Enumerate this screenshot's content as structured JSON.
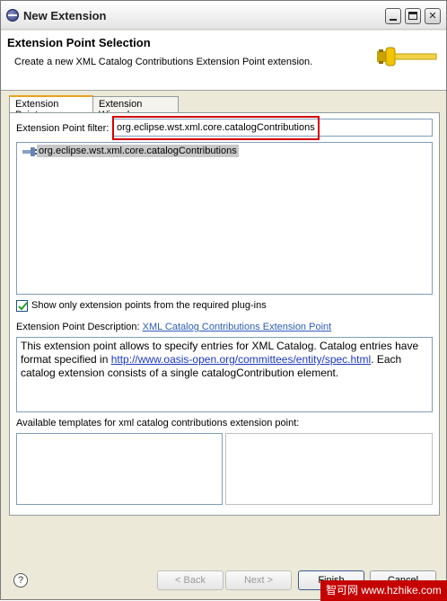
{
  "window": {
    "title": "New Extension",
    "minimize_icon": "minimize-icon",
    "maximize_icon": "maximize-icon",
    "close_icon": "close-icon",
    "close_glyph": "✕"
  },
  "header": {
    "title": "Extension Point Selection",
    "description": "Create a new XML Catalog Contributions Extension Point extension."
  },
  "tabs": [
    {
      "label": "Extension Points",
      "active": true
    },
    {
      "label": "Extension Wizards",
      "active": false
    }
  ],
  "filter": {
    "label": "Extension Point filter:",
    "value": "org.eclipse.wst.xml.core.catalogContributions"
  },
  "extension_list": {
    "items": [
      {
        "label": "org.eclipse.wst.xml.core.catalogContributions",
        "icon": "plug-icon",
        "selected": true
      }
    ]
  },
  "show_only_checkbox": {
    "label": "Show only extension points from the required plug-ins",
    "checked": true
  },
  "description": {
    "label": "Extension Point Description:",
    "link_text": "XML Catalog Contributions Extension Point",
    "text_before": "This extension point allows to specify entries for XML Catalog. Catalog entries have format specified in ",
    "url_text": "http://www.oasis-open.org/committees/entity/spec.html",
    "text_after": ". Each catalog extension consists of a single catalogContribution element."
  },
  "templates": {
    "label": "Available templates for xml catalog contributions extension point:"
  },
  "footer": {
    "help_glyph": "?",
    "back_label": "< Back",
    "next_label": "Next >",
    "finish_label": "Finish",
    "cancel_label": "Cancel"
  },
  "watermark": {
    "text": "智可网 www.hzhike.com"
  },
  "colors": {
    "highlight_border": "#d20000",
    "link": "#2e5cb8",
    "selection": "#c8c8c8",
    "tab_accent": "#e8a21e"
  }
}
